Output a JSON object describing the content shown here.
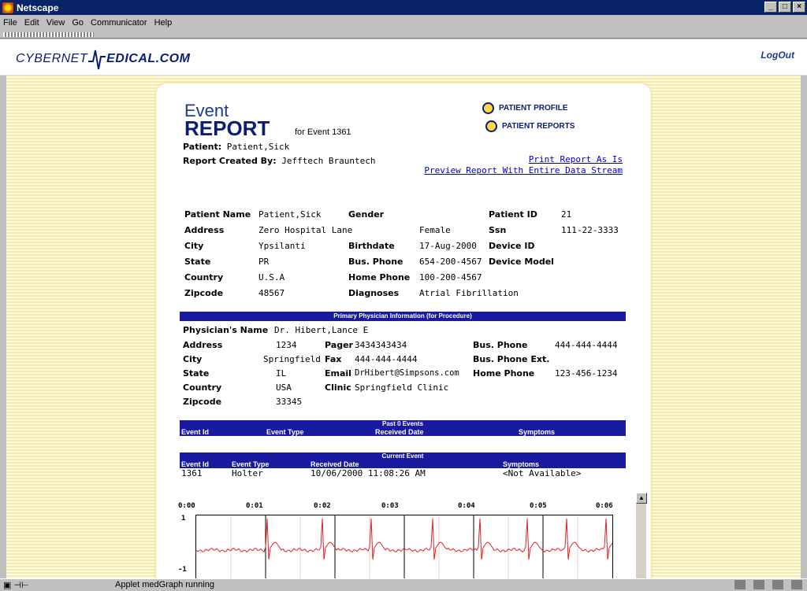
{
  "window": {
    "title": "Netscape"
  },
  "menu": [
    "File",
    "Edit",
    "View",
    "Go",
    "Communicator",
    "Help"
  ],
  "site": {
    "logo_a": "CYBERNET",
    "logo_b": "EDICAL.COM",
    "logout": "LogOut"
  },
  "report": {
    "title_word1": "Event",
    "title_word2": "REPORT",
    "for_event": "for Event 1361",
    "patient_label": "Patient:",
    "patient_value": "Patient,Sick",
    "created_label": "Report Created By:",
    "created_value": "Jefftech Brauntech",
    "nav": [
      "PATIENT PROFILE",
      "PATIENT REPORTS"
    ],
    "links": [
      "Print Report As Is",
      "Preview Report With Entire Data Stream"
    ]
  },
  "patient": {
    "col1": [
      {
        "label": "Patient Name",
        "value": "Patient,Sick"
      },
      {
        "label": "Address",
        "value": "Zero Hospital Lane"
      },
      {
        "label": "City",
        "value": "Ypsilanti"
      },
      {
        "label": "State",
        "value": "PR"
      },
      {
        "label": "Country",
        "value": "U.S.A"
      },
      {
        "label": "Zipcode",
        "value": "48567"
      }
    ],
    "col2": [
      {
        "label": "Gender",
        "value": "Female"
      },
      {
        "label": "Birthdate",
        "value": "17-Aug-2000"
      },
      {
        "label": "Bus. Phone",
        "value": "654-200-4567"
      },
      {
        "label": "Home Phone",
        "value": "100-200-4567"
      },
      {
        "label": "Diagnoses",
        "value": "Atrial Fibrillation"
      }
    ],
    "col3": [
      {
        "label": "Patient ID",
        "value": "21"
      },
      {
        "label": "Ssn",
        "value": "111-22-3333"
      },
      {
        "label": "Device ID",
        "value": ""
      },
      {
        "label": "Device Model",
        "value": ""
      }
    ]
  },
  "physician": {
    "header": "Primary Physician Information (for Procedure)",
    "name_label": "Physician's Name",
    "name_value": "Dr. Hibert,Lance E",
    "col1": [
      {
        "label": "Address",
        "value": "1234"
      },
      {
        "label": "City",
        "value": "Springfield"
      },
      {
        "label": "State",
        "value": "IL"
      },
      {
        "label": "Country",
        "value": "USA"
      },
      {
        "label": "Zipcode",
        "value": "33345"
      }
    ],
    "col2": [
      {
        "label": "Pager",
        "value": "3434343434"
      },
      {
        "label": "Fax",
        "value": "444-444-4444"
      },
      {
        "label": "Email",
        "value": "DrHibert@Simpsons.com"
      },
      {
        "label": "Clinic",
        "value": "Springfield Clinic"
      }
    ],
    "col3": [
      {
        "label": "Bus. Phone",
        "value": "444-444-4444"
      },
      {
        "label": "Bus. Phone Ext.",
        "value": ""
      },
      {
        "label": "Home Phone",
        "value": "123-456-1234"
      }
    ]
  },
  "past_events": {
    "header": "Past 0 Events",
    "columns": [
      "Event Id",
      "Event Type",
      "Received Date",
      "Symptoms"
    ]
  },
  "current_event": {
    "header": "Current Event",
    "columns": [
      "Event Id",
      "Event Type",
      "Received Date",
      "Symptoms"
    ],
    "row": [
      "1361",
      "Holter",
      "10/06/2000 11:08:26 AM",
      "<Not Available>"
    ]
  },
  "graph": {
    "time_ticks": [
      "0:00",
      "0:01",
      "0:02",
      "0:03",
      "0:04",
      "0:05",
      "0:06"
    ],
    "y_top": "1",
    "y_bottom": "-1",
    "line_color": "#e02020"
  },
  "status": {
    "text": "Applet medGraph running"
  }
}
